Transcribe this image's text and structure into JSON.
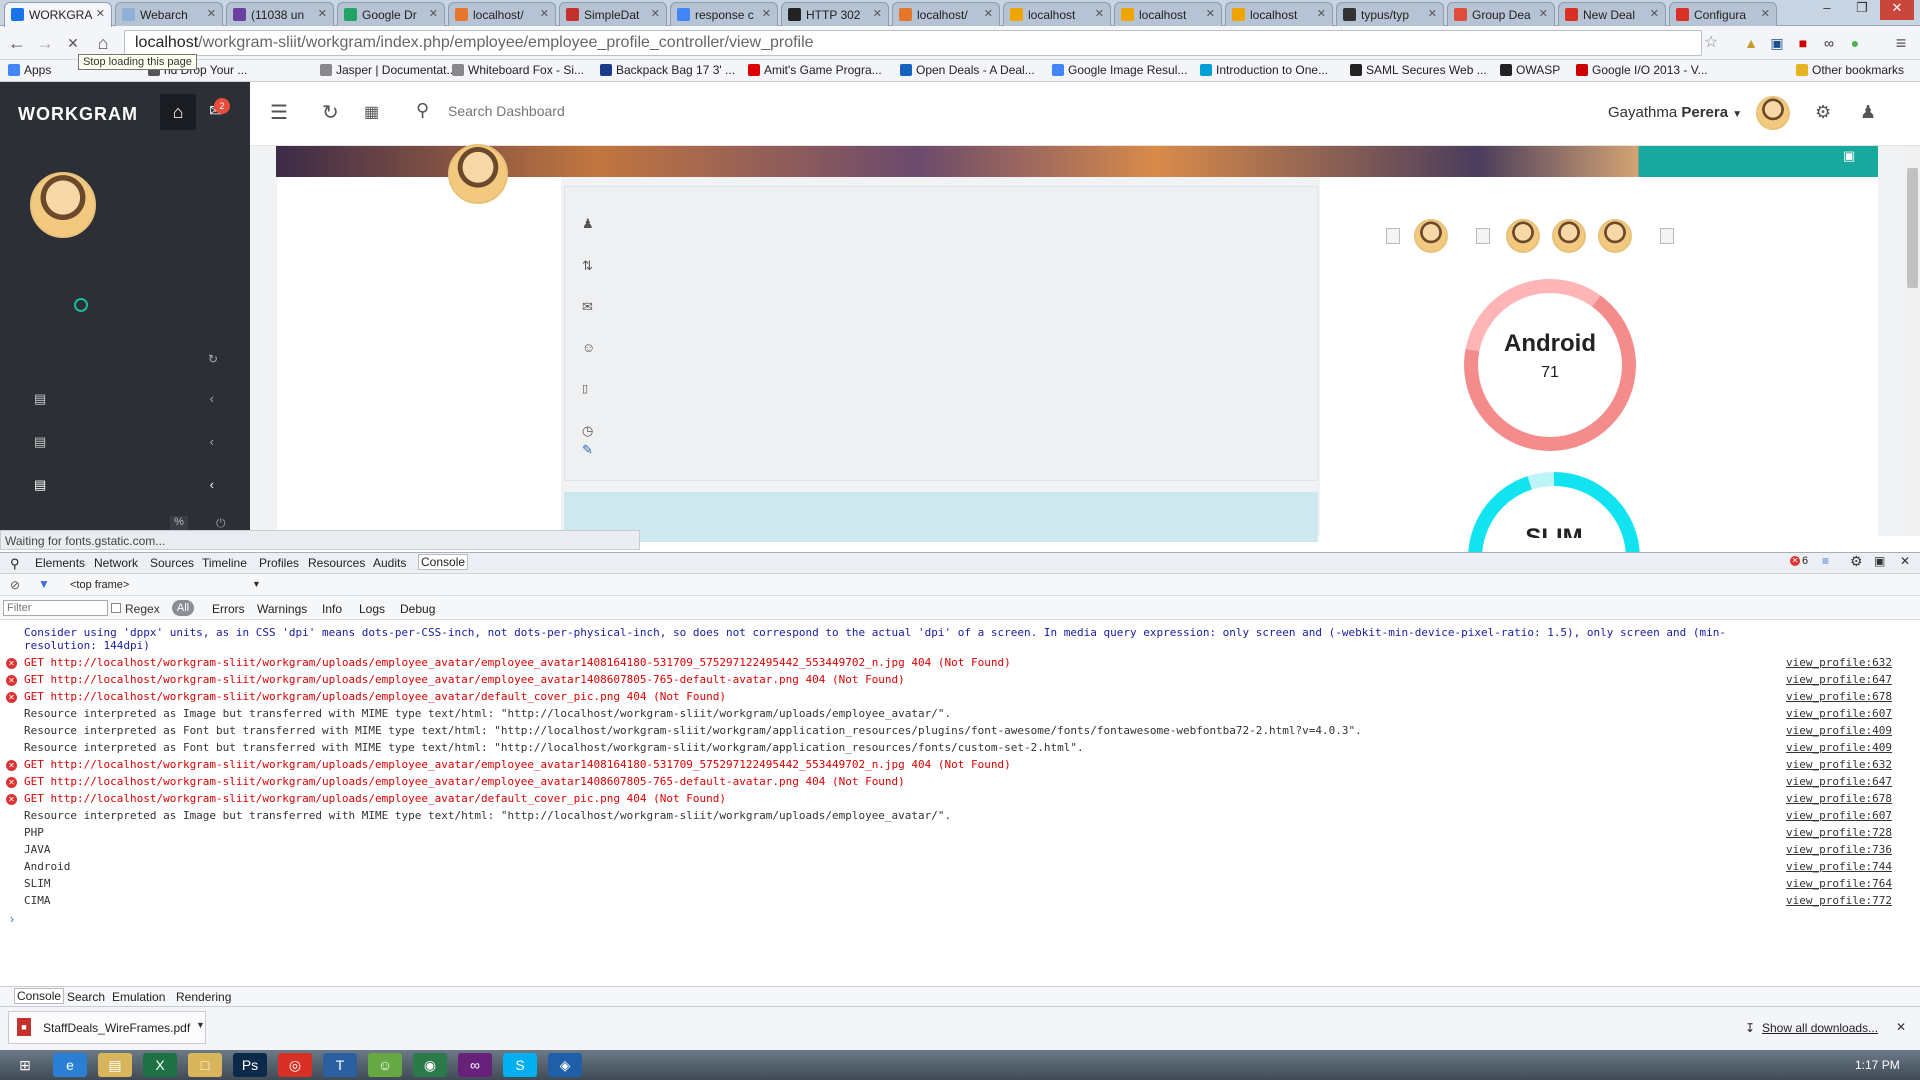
{
  "browser": {
    "tabs": [
      "WORKGRA",
      "Webarch",
      "(11038 un",
      "Google Dr",
      "localhost/",
      "SimpleDat",
      "response c",
      "HTTP 302",
      "localhost/",
      "localhost",
      "localhost",
      "localhost",
      "typus/typ",
      "Group Dea",
      "New Deal",
      "Configura"
    ],
    "url_host": "localhost",
    "url_path": "/workgram-sliit/workgram/index.php/employee/employee_profile_controller/view_profile",
    "tooltip": "Stop loading this page",
    "bookmarks": [
      "Apps",
      "nd Drop Your ...",
      "Jasper | Documentat...",
      "Whiteboard Fox - Si...",
      "Backpack Bag 17 3' ...",
      "Amit's Game Progra...",
      "Open Deals - A Deal...",
      "Google Image Resul...",
      "Introduction to One...",
      "SAML Secures Web ...",
      "OWASP",
      "Google I/O 2013 - V...",
      "Other bookmarks"
    ],
    "status": "Waiting for fonts.gstatic.com..."
  },
  "app": {
    "brand": "WORKGRAM",
    "mail_count": "2",
    "search_placeholder": "Search Dashboard",
    "user_first": "Gayathma",
    "user_last": "Perera",
    "percent": "%"
  },
  "profile": {
    "skills": [
      {
        "name": "Android",
        "value": "71"
      },
      {
        "name": "SLIM",
        "value": ""
      }
    ]
  },
  "devtools": {
    "tabs": [
      "Elements",
      "Network",
      "Sources",
      "Timeline",
      "Profiles",
      "Resources",
      "Audits",
      "Console"
    ],
    "frame": "<top frame>",
    "filter_placeholder": "Filter",
    "regex": "Regex",
    "levels": [
      "All",
      "Errors",
      "Warnings",
      "Info",
      "Logs",
      "Debug"
    ],
    "error_count": "6",
    "bottom_tabs": [
      "Console",
      "Search",
      "Emulation",
      "Rendering"
    ],
    "lines": [
      {
        "type": "warn",
        "text": "Consider using 'dppx' units, as in CSS 'dpi' means dots-per-CSS-inch, not dots-per-physical-inch, so does not correspond to the actual 'dpi' of a screen. In media query expression: only screen and (-webkit-min-device-pixel-ratio: 1.5), only screen and (min-",
        "src": ""
      },
      {
        "type": "warn",
        "text": "resolution: 144dpi)",
        "src": ""
      },
      {
        "type": "err",
        "text": "GET http://localhost/workgram-sliit/workgram/uploads/employee_avatar/employee_avatar1408164180-531709_575297122495442_553449702_n.jpg 404 (Not Found)",
        "src": "view_profile:632"
      },
      {
        "type": "err",
        "text": "GET http://localhost/workgram-sliit/workgram/uploads/employee_avatar/employee_avatar1408607805-765-default-avatar.png 404 (Not Found)",
        "src": "view_profile:647"
      },
      {
        "type": "err",
        "text": "GET http://localhost/workgram-sliit/workgram/uploads/employee_avatar/default_cover_pic.png 404 (Not Found)",
        "src": "view_profile:678"
      },
      {
        "type": "log",
        "text": "Resource interpreted as Image but transferred with MIME type text/html: \"http://localhost/workgram-sliit/workgram/uploads/employee_avatar/\".",
        "src": "view_profile:607"
      },
      {
        "type": "log",
        "text": "Resource interpreted as Font but transferred with MIME type text/html: \"http://localhost/workgram-sliit/workgram/application_resources/plugins/font-awesome/fonts/fontawesome-webfontba72-2.html?v=4.0.3\".",
        "src": "view_profile:409"
      },
      {
        "type": "log",
        "text": "Resource interpreted as Font but transferred with MIME type text/html: \"http://localhost/workgram-sliit/workgram/application_resources/fonts/custom-set-2.html\".",
        "src": "view_profile:409"
      },
      {
        "type": "err",
        "text": "GET http://localhost/workgram-sliit/workgram/uploads/employee_avatar/employee_avatar1408164180-531709_575297122495442_553449702_n.jpg 404 (Not Found)",
        "src": "view_profile:632"
      },
      {
        "type": "err",
        "text": "GET http://localhost/workgram-sliit/workgram/uploads/employee_avatar/employee_avatar1408607805-765-default-avatar.png 404 (Not Found)",
        "src": "view_profile:647"
      },
      {
        "type": "err",
        "text": "GET http://localhost/workgram-sliit/workgram/uploads/employee_avatar/default_cover_pic.png 404 (Not Found)",
        "src": "view_profile:678"
      },
      {
        "type": "log",
        "text": "Resource interpreted as Image but transferred with MIME type text/html: \"http://localhost/workgram-sliit/workgram/uploads/employee_avatar/\".",
        "src": "view_profile:607"
      },
      {
        "type": "log",
        "text": "PHP",
        "src": "view_profile:728"
      },
      {
        "type": "log",
        "text": "JAVA",
        "src": "view_profile:736"
      },
      {
        "type": "log",
        "text": "Android",
        "src": "view_profile:744"
      },
      {
        "type": "log",
        "text": "SLIM",
        "src": "view_profile:764"
      },
      {
        "type": "log",
        "text": "CIMA",
        "src": "view_profile:772"
      }
    ]
  },
  "downloads": {
    "file": "StaffDeals_WireFrames.pdf",
    "show_all": "Show all downloads..."
  },
  "taskbar": {
    "time": "1:17 PM"
  },
  "colors": {
    "sidebar": "#2c2f36",
    "android_ring": "#f58c8c",
    "slim_ring": "#12e3f0",
    "teal": "#18a89d"
  }
}
